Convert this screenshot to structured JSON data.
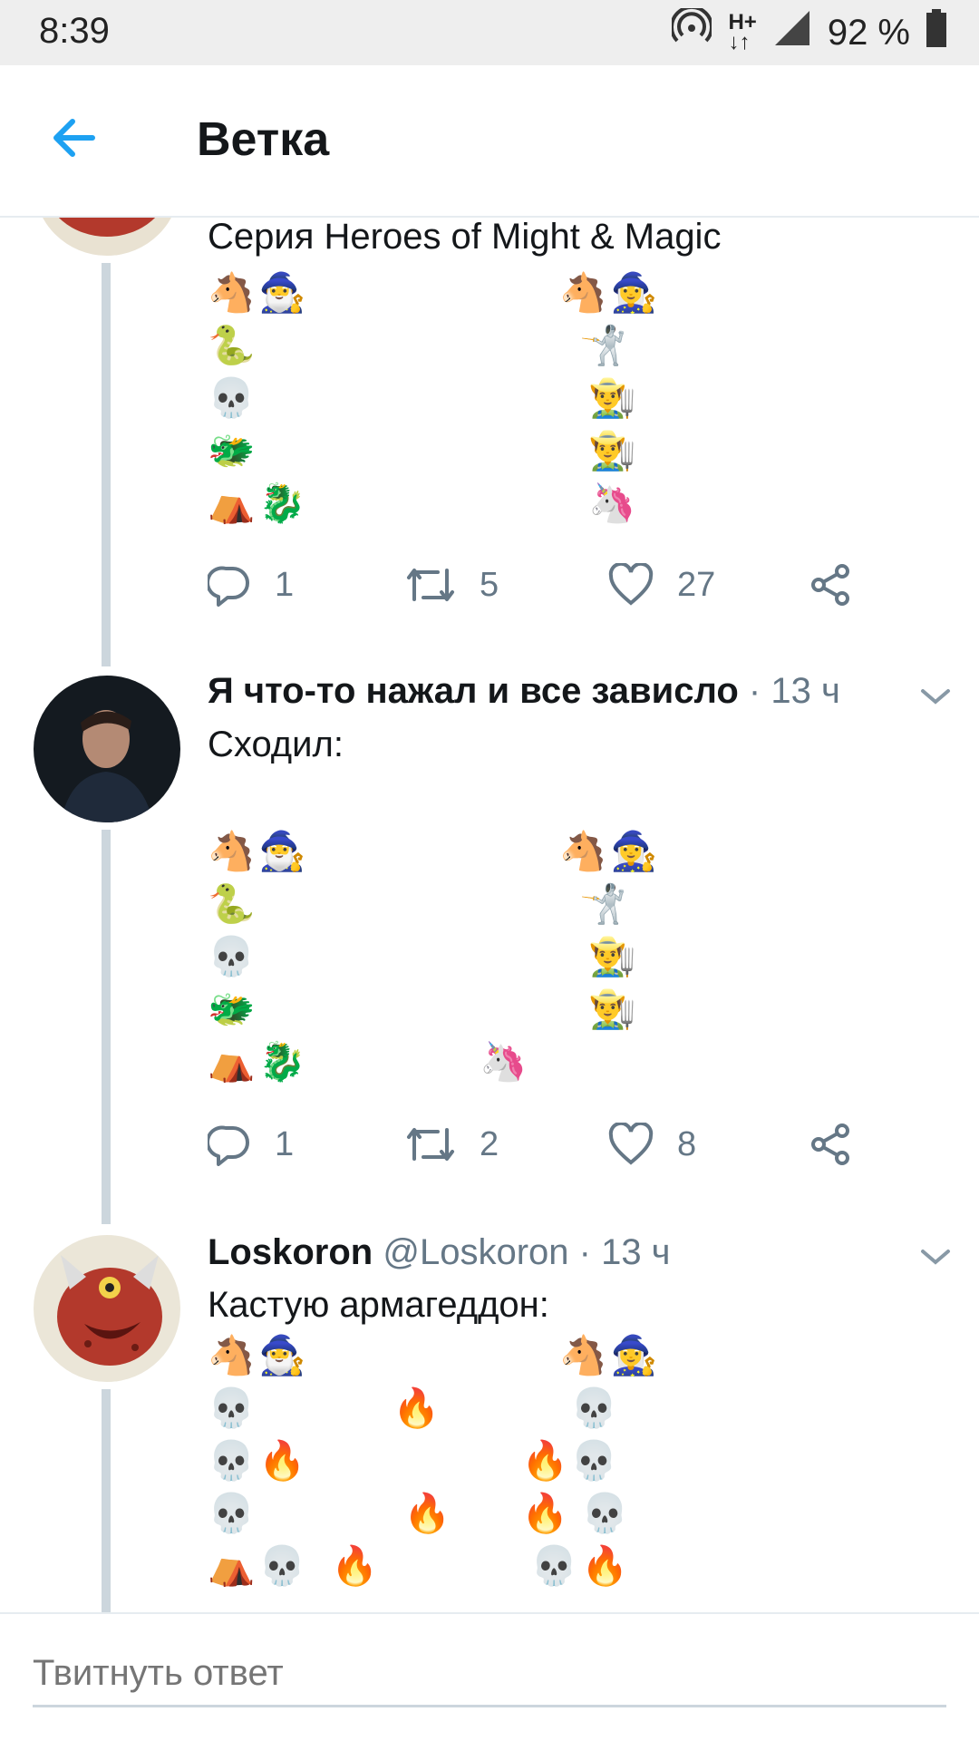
{
  "status_bar": {
    "time": "8:39",
    "network": "H+",
    "battery": "92 %"
  },
  "header": {
    "title": "Ветка"
  },
  "tweets": [
    {
      "text": "Серия Heroes of Might & Magic",
      "emoji_rows_left": [
        [
          "🐴",
          "🧙‍♂️"
        ],
        [
          "🐍"
        ],
        [
          "💀"
        ],
        [
          "🐲"
        ],
        [
          "⛺",
          "🐉"
        ]
      ],
      "emoji_rows_right": [
        [
          "🐴",
          "🧙‍♀️"
        ],
        [
          "🤺"
        ],
        [
          "👨‍🌾"
        ],
        [
          "👨‍🌾"
        ],
        [
          "🦄"
        ]
      ],
      "replies": "1",
      "retweets": "5",
      "likes": "27"
    },
    {
      "author": "Я что-то нажал и все зависло",
      "time": "13 ч",
      "text": "Сходил:",
      "emoji_rows_left": [
        [
          "🐴",
          "🧙‍♂️"
        ],
        [
          "🐍"
        ],
        [
          "💀"
        ],
        [
          "🐲"
        ],
        [
          "⛺",
          "🐉"
        ]
      ],
      "emoji_rows_right": [
        [
          "🐴",
          "🧙‍♀️"
        ],
        [
          "🤺"
        ],
        [
          "👨‍🌾"
        ],
        [
          "👨‍🌾"
        ],
        []
      ],
      "emoji_middle": "🦄",
      "replies": "1",
      "retweets": "2",
      "likes": "8"
    },
    {
      "author": "Loskoron",
      "handle": "@Loskoron",
      "time": "13 ч",
      "text": "Кастую армагеддон:",
      "emoji_row1_left": [
        "🐴",
        "🧙‍♂️"
      ],
      "emoji_row1_right": [
        "🐴",
        "🧙‍♀️"
      ],
      "skull": "💀",
      "fire": "🔥",
      "camp": "⛺"
    }
  ],
  "reply_bar": {
    "placeholder": "Твитнуть ответ"
  },
  "colors": {
    "accent": "#1da1f2",
    "secondary_text": "#657786",
    "thread_line": "#ccd6dd"
  }
}
